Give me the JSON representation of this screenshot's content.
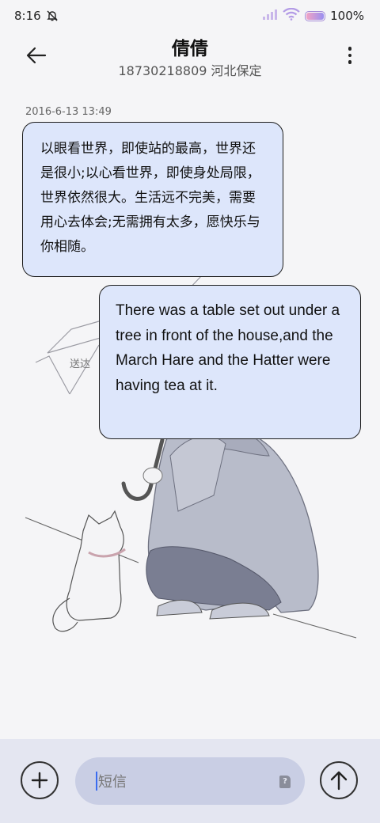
{
  "status_bar": {
    "time": "8:16",
    "battery": "100%"
  },
  "header": {
    "contact_name": "倩倩",
    "contact_detail": "18730218809 河北保定"
  },
  "conversation": {
    "timestamp": "2016-6-13 13:49",
    "messages": [
      {
        "text": "以眼看世界，即使站的最高，世界还是很小;以心看世界，即使身处局限，世界依然很大。生活远不完美，需要用心去体会;无需拥有太多，愿快乐与你相随。"
      },
      {
        "text": "There was a table set out under a tree in front of the house,and the March Hare and the Hatter were having tea at it."
      }
    ],
    "background_caption": "送达"
  },
  "composer": {
    "placeholder": "短信",
    "sim_label": "?"
  },
  "icons": {
    "back": "back-arrow-icon",
    "more": "more-vertical-icon",
    "add": "plus-icon",
    "send": "arrow-up-icon",
    "silent": "bell-off-icon",
    "signal": "signal-icon",
    "wifi": "wifi-icon",
    "battery": "battery-icon"
  },
  "colors": {
    "bubble_fill": "#dde6fb",
    "composer_bg": "#e4e6f1",
    "input_bg": "#c9cee4",
    "caret": "#3a6cf0"
  }
}
